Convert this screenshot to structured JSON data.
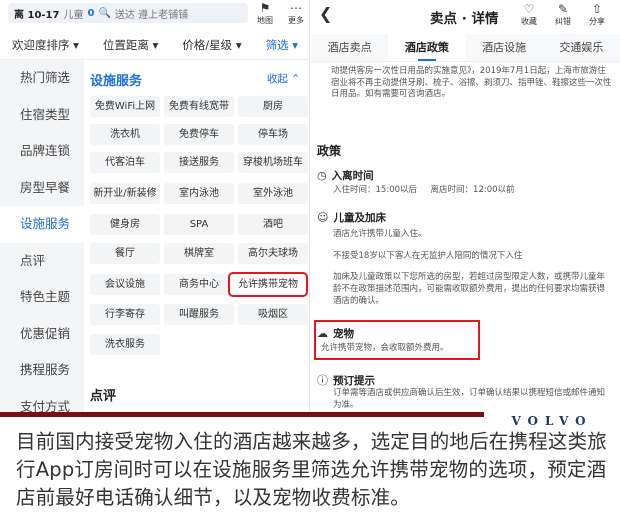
{
  "left": {
    "search": {
      "date_range": "离 10-17",
      "kids_label": "儿童",
      "kids_count": "0",
      "placeholder": "送达 遵上老铺铺"
    },
    "map_label": "地图",
    "more_label": "更多",
    "filters": [
      "欢迎度排序",
      "位置距离",
      "价格/星级",
      "筛选"
    ],
    "nav": [
      "热门筛选",
      "住宿类型",
      "品牌连锁",
      "房型早餐",
      "设施服务",
      "点评",
      "特色主题",
      "优惠促销",
      "携程服务",
      "支付方式"
    ],
    "section_title": "设施服务",
    "collapse_label": "收起",
    "chips": [
      "免费WiFi上网",
      "免费有线宽带",
      "厨房",
      "洗衣机",
      "免费停车",
      "停车场",
      "代客泊车",
      "接送服务",
      "穿梭机场班车",
      "新开业/新装修",
      "室内泳池",
      "室外泳池",
      "健身房",
      "SPA",
      "酒吧",
      "餐厅",
      "棋牌室",
      "高尔夫球场",
      "会议设施",
      "商务中心",
      "允许携带宠物",
      "行李寄存",
      "叫醒服务",
      "吸烟区",
      "洗衣服务"
    ],
    "highlighted_chip": "允许携带宠物",
    "review_title": "点评"
  },
  "right": {
    "title": "卖点 · 详情",
    "icons": {
      "collect": "收藏",
      "correct": "纠错",
      "share": "分享"
    },
    "tabs": [
      "酒店卖点",
      "酒店政策",
      "酒店设施",
      "交通娱乐"
    ],
    "active_tab": "酒店政策",
    "notice": "动提供客房一次性日用品的实施意见》，2019年7月1日起，上海市旅游住宿业将不再主动提供牙刷、梳子、浴擦、剃须刀、指甲锉、鞋擦这些一次性日用品。如有需要可咨询酒店。",
    "policy_title": "政策",
    "checkin": {
      "title": "入离时间",
      "in_label": "入住时间：",
      "in_value": "15:00以后",
      "out_label": "离店时间：",
      "out_value": "12:00以前"
    },
    "children": {
      "title": "儿童及加床",
      "line1": "酒店允许携带儿童入住。",
      "line2": "不接受18岁以下客人在无监护人陪同的情况下入住",
      "line3": "加床及儿童政策以下您所选的房型，若超过房型限定人数，或携带儿童年龄不在政策描述范围内，可能需收取额外费用，提出的任何要求均需获得酒店的确认。"
    },
    "pets": {
      "title": "宠物",
      "text": "允许携带宠物，会收取额外费用。"
    },
    "booking": {
      "title": "预订提示",
      "text": "订单需等酒店或供应商确认后生效，订单确认结果以携程短信或邮件通知为准。"
    }
  },
  "watermark": "VOLVO",
  "caption": "目前国内接受宠物入住的酒店越来越多，选定目的地后在携程这类旅行App订房间时可以在设施服务里筛选允许携带宠物的选项，预定酒店前最好电话确认细节，以及宠物收费标准。",
  "colors": {
    "accent": "#1e6fe0",
    "highlight": "#e4161e"
  }
}
